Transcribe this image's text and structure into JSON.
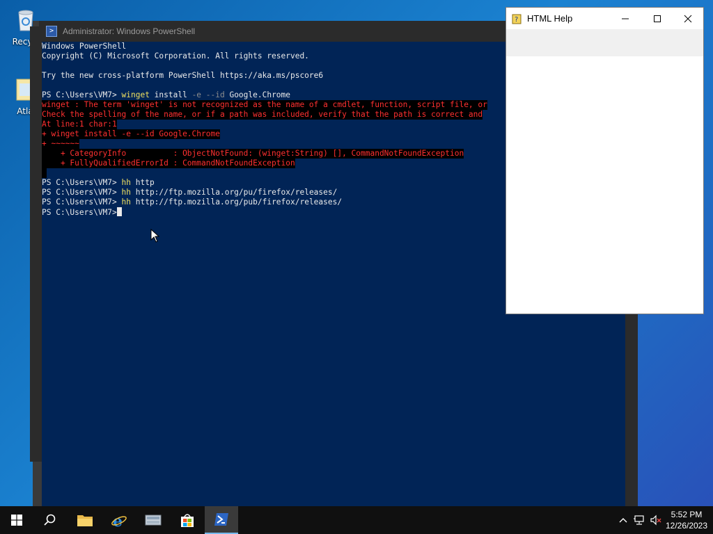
{
  "desktop": {
    "icons": [
      {
        "label": "Recycl"
      },
      {
        "label": "Atla"
      }
    ]
  },
  "powershell": {
    "title": "Administrator: Windows PowerShell",
    "lines": [
      {
        "text": "Windows PowerShell",
        "type": "out"
      },
      {
        "text": "Copyright (C) Microsoft Corporation. All rights reserved.",
        "type": "out"
      },
      {
        "text": "",
        "type": "out"
      },
      {
        "text": "Try the new cross-platform PowerShell https://aka.ms/pscore6",
        "type": "out"
      },
      {
        "text": "",
        "type": "out"
      },
      {
        "prompt": "PS C:\\Users\\VM7> ",
        "cmd": "winget",
        "rest1": " install ",
        "flags": "-e --id",
        "rest2": " Google.Chrome",
        "type": "cmdline"
      },
      {
        "text": "winget : The term 'winget' is not recognized as the name of a cmdlet, function, script file, or",
        "type": "err"
      },
      {
        "text": "Check the spelling of the name, or if a path was included, verify that the path is correct and",
        "type": "err"
      },
      {
        "text": "At line:1 char:1",
        "type": "err"
      },
      {
        "text": "+ winget install -e --id Google.Chrome",
        "type": "err"
      },
      {
        "text": "+ ~~~~~~",
        "type": "err"
      },
      {
        "text": "    + CategoryInfo          : ObjectNotFound: (winget:String) [], CommandNotFoundException",
        "type": "err"
      },
      {
        "text": "    + FullyQualifiedErrorId : CommandNotFoundException",
        "type": "err"
      },
      {
        "text": " ",
        "type": "err"
      },
      {
        "prompt": "PS C:\\Users\\VM7> ",
        "cmd": "hh",
        "rest1": " http",
        "flags": "",
        "rest2": "",
        "type": "cmdline"
      },
      {
        "prompt": "PS C:\\Users\\VM7> ",
        "cmd": "hh",
        "rest1": " http://ftp.mozilla.org/pu/firefox/releases/",
        "flags": "",
        "rest2": "",
        "type": "cmdline"
      },
      {
        "prompt": "PS C:\\Users\\VM7> ",
        "cmd": "hh",
        "rest1": " http://ftp.mozilla.org/pub/firefox/releases/",
        "flags": "",
        "rest2": "",
        "type": "cmdline"
      },
      {
        "prompt": "PS C:\\Users\\VM7>",
        "cmd": "",
        "rest1": "",
        "flags": "",
        "rest2": "",
        "type": "current"
      }
    ]
  },
  "html_help": {
    "title": "HTML Help",
    "minimize_symbol": "—",
    "maximize_symbol": "☐",
    "close_symbol": "✕"
  },
  "taskbar": {
    "buttons": [
      "start-icon",
      "search-icon",
      "file-explorer-icon",
      "internet-explorer-icon",
      "server-manager-icon",
      "store-icon",
      "powershell-icon"
    ],
    "active": "powershell-icon",
    "tray": {
      "chevron": "^"
    },
    "clock": {
      "time": "5:52 PM",
      "date": "12/26/2023"
    }
  },
  "colors": {
    "ps_background": "#012456",
    "ps_error": "#ff3030",
    "ps_command": "#f0e060",
    "taskbar": "#101010"
  }
}
